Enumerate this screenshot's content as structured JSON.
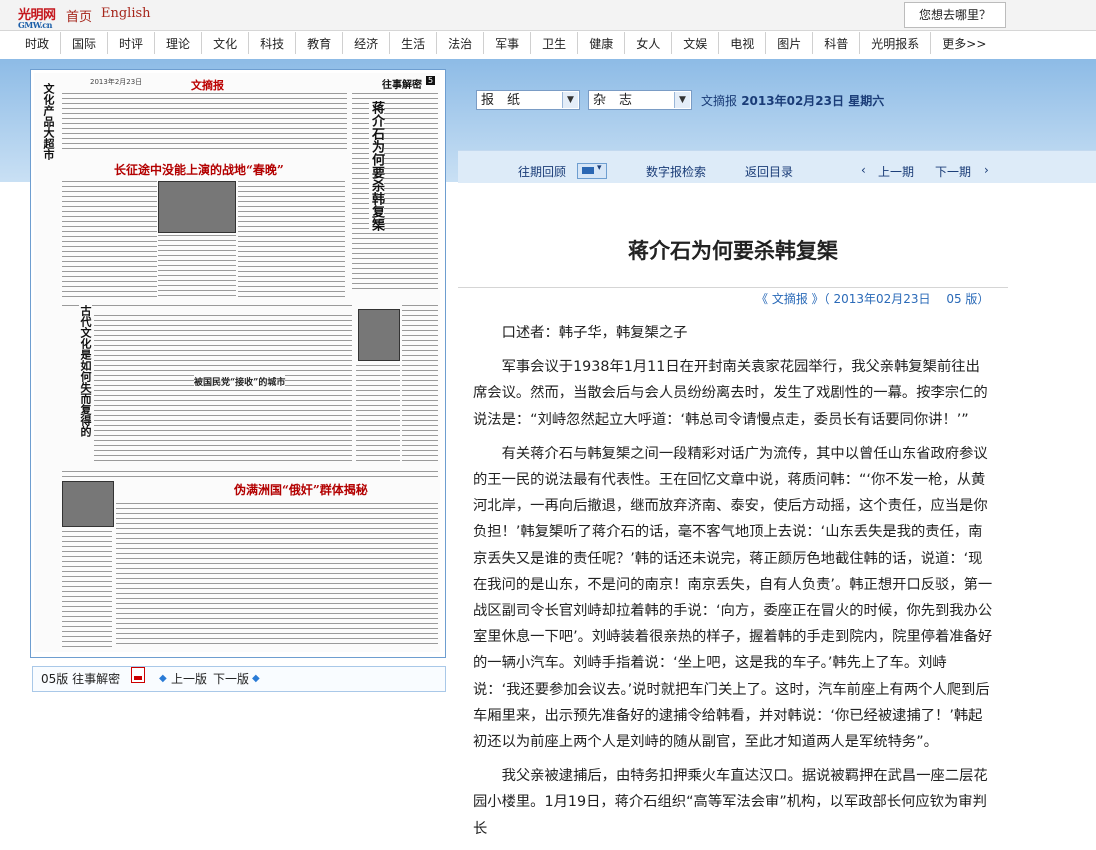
{
  "site": {
    "logo_text": "光明网",
    "logo_sub": "GMW.cn",
    "home_link": "首页",
    "english_link": "English",
    "goto_button": "您想去哪里？"
  },
  "nav": {
    "items": [
      "时政",
      "国际",
      "时评",
      "理论",
      "文化",
      "科技",
      "教育",
      "经济",
      "生活",
      "法治",
      "军事",
      "卫生",
      "健康",
      "女人",
      "文娱",
      "电视",
      "图片",
      "科普",
      "光明报系",
      "更多>>"
    ]
  },
  "selectors": {
    "paper_select": "报　纸",
    "magazine_select": "杂　志"
  },
  "edition": {
    "publication": "文摘报",
    "date": "2013年02月23日",
    "weekday": "星期六"
  },
  "toolbar": {
    "history": "往期回顾",
    "search": "数字报检索",
    "back_to_index": "返回目录",
    "prev_issue": "上一期",
    "next_issue": "下一期",
    "prev_glyph": "‹",
    "next_glyph": "›"
  },
  "page_thumb": {
    "masthead": "文摘报",
    "date": "2013年2月23日",
    "column": "往事解密",
    "page_no": "5",
    "vertical_left": "文化产品大超市",
    "headline_1": "长征途中没能上演的战地“春晚”",
    "headline_2": "蒋介石为何要杀韩复榘",
    "headline_3": "古代文化是如何失而复得的",
    "headline_4": "被国民党“接收”的城市",
    "headline_5": "伪满洲国“俄奸”群体揭秘"
  },
  "page_bar": {
    "page_label": "05版 往事解密",
    "prev_page": "上一版",
    "next_page": "下一版"
  },
  "article": {
    "title": "蒋介石为何要杀韩复榘",
    "source": "《 文摘报 》（ 2013年02月23日　 05 版）",
    "paragraphs": [
      "口述者：韩子华，韩复榘之子",
      "军事会议于1938年1月11日在开封南关袁家花园举行，我父亲韩复榘前往出席会议。然而，当散会后与会人员纷纷离去时，发生了戏剧性的一幕。按李宗仁的说法是：“刘峙忽然起立大呼道：‘韩总司令请慢点走，委员长有话要同你讲！’”",
      "有关蒋介石与韩复榘之间一段精彩对话广为流传，其中以曾任山东省政府参议的王一民的说法最有代表性。王在回忆文章中说，蒋质问韩：“‘你不发一枪，从黄河北岸，一再向后撤退，继而放弃济南、泰安，使后方动摇，这个责任，应当是你负担！’韩复榘听了蒋介石的话，毫不客气地顶上去说：‘山东丢失是我的责任，南京丢失又是谁的责任呢？’韩的话还未说完，蒋正颜厉色地截住韩的话，说道：‘现在我问的是山东，不是问的南京！南京丢失，自有人负责’。韩正想开口反驳，第一战区副司令长官刘峙却拉着韩的手说：‘向方，委座正在冒火的时候，你先到我办公室里休息一下吧’。刘峙装着很亲热的样子，握着韩的手走到院内，院里停着准备好的一辆小汽车。刘峙手指着说：‘坐上吧，这是我的车子。’韩先上了车。刘峙说：‘我还要参加会议去。’说时就把车门关上了。这时，汽车前座上有两个人爬到后车厢里来，出示预先准备好的逮捕令给韩看，并对韩说：‘你已经被逮捕了！’韩起初还以为前座上两个人是刘峙的随从副官，至此才知道两人是军统特务”。",
      "我父亲被逮捕后，由特务扣押乘火车直达汉口。据说被羁押在武昌一座二层花园小楼里。1月19日，蒋介石组织“高等军法会审”机构，以军政部长何应钦为审判长"
    ]
  }
}
